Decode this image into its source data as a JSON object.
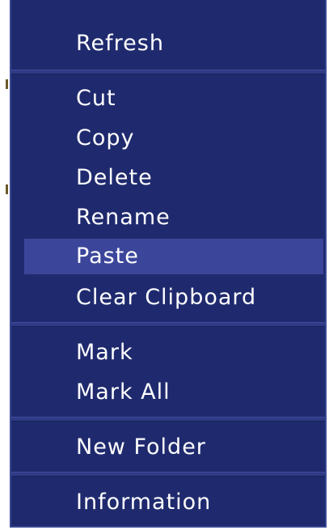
{
  "context_menu": {
    "items": [
      {
        "label": "Refresh"
      },
      {
        "label": "Cut"
      },
      {
        "label": "Copy"
      },
      {
        "label": "Delete"
      },
      {
        "label": "Rename"
      },
      {
        "label": "Paste",
        "highlighted": true
      },
      {
        "label": "Clear Clipboard"
      },
      {
        "label": "Mark"
      },
      {
        "label": "Mark All"
      },
      {
        "label": "New Folder"
      },
      {
        "label": "Information"
      }
    ]
  },
  "colors": {
    "menu_background": "#1f2a6e",
    "highlight": "#3b469a",
    "separator": "#2f3b86",
    "text": "#ffffff"
  }
}
